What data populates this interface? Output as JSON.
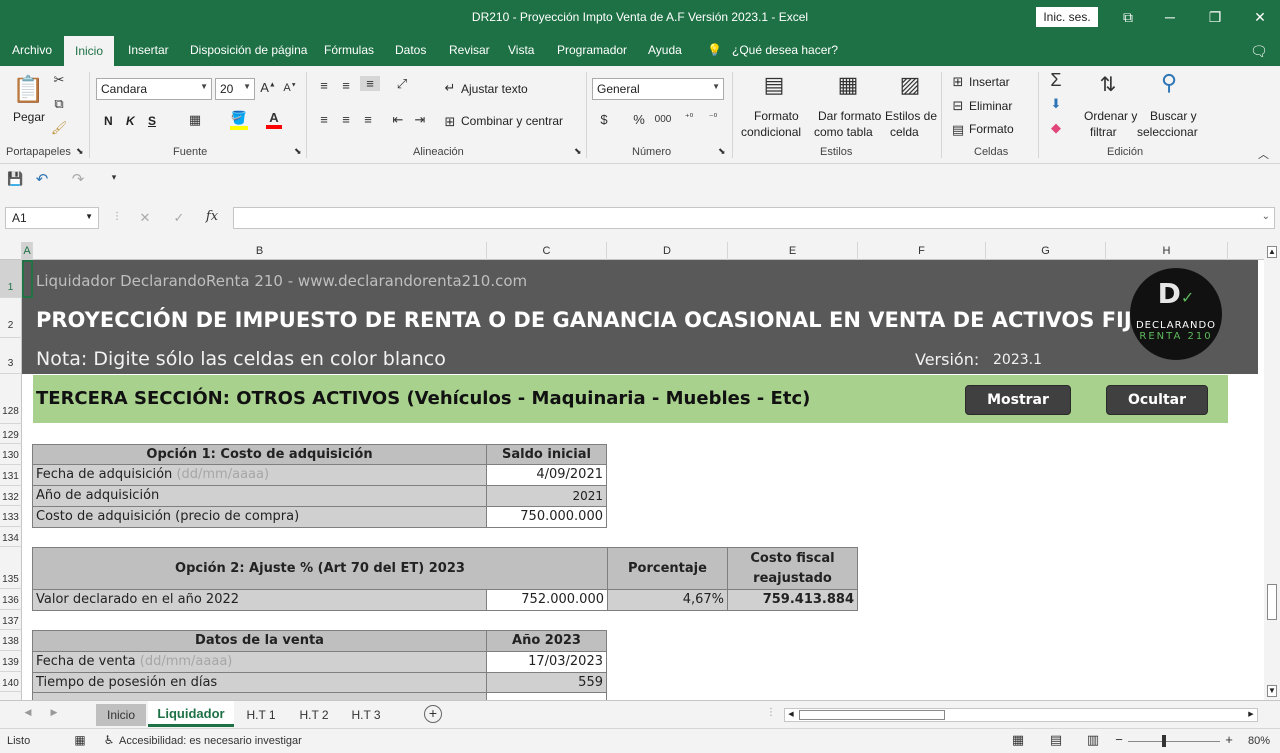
{
  "window": {
    "title": "DR210 - Proyección Impto Venta de A.F Versión 2023.1  -  Excel",
    "signin": "Inic. ses."
  },
  "menu": [
    "Archivo",
    "Inicio",
    "Insertar",
    "Disposición de página",
    "Fórmulas",
    "Datos",
    "Revisar",
    "Vista",
    "Programador",
    "Ayuda",
    "¿Qué desea hacer?"
  ],
  "ribbon": {
    "clipboard": {
      "paste": "Pegar",
      "group": "Portapapeles"
    },
    "font": {
      "name": "Candara",
      "size": "20",
      "bold": "N",
      "italic": "K",
      "underline": "S",
      "group": "Fuente"
    },
    "alignment": {
      "wrap": "Ajustar texto",
      "merge": "Combinar y centrar",
      "group": "Alineación"
    },
    "number": {
      "format": "General",
      "group": "Número"
    },
    "styles": {
      "conditional": [
        "Formato",
        "condicional"
      ],
      "table": [
        "Dar formato",
        "como tabla"
      ],
      "cell": [
        "Estilos de",
        "celda"
      ],
      "group": "Estilos"
    },
    "cells": {
      "insert": "Insertar",
      "delete": "Eliminar",
      "format": "Formato",
      "group": "Celdas"
    },
    "editing": {
      "sort": [
        "Ordenar y",
        "filtrar"
      ],
      "find": [
        "Buscar y",
        "seleccionar"
      ],
      "group": "Edición"
    }
  },
  "formula_bar": {
    "name_box": "A1",
    "formula": ""
  },
  "columns": [
    "A",
    "B",
    "C",
    "D",
    "E",
    "F",
    "G",
    "H"
  ],
  "rows": [
    "1",
    "2",
    "3",
    "128",
    "129",
    "130",
    "131",
    "132",
    "133",
    "134",
    "135",
    "136",
    "137",
    "138",
    "139",
    "140"
  ],
  "banner": {
    "line1": "Liquidador DeclarandoRenta 210 - www.declarandorenta210.com",
    "line2": "PROYECCIÓN DE IMPUESTO DE RENTA O DE GANANCIA OCASIONAL EN VENTA DE ACTIVOS FIJOS",
    "line3": "Nota: Digite sólo las celdas en color blanco",
    "version_label": "Versión:",
    "version": "2023.1",
    "logo_top": "DECLARANDO",
    "logo_bottom": "RENTA 210"
  },
  "section": {
    "title": "TERCERA SECCIÓN: OTROS ACTIVOS (Vehículos - Maquinaria - Muebles - Etc)",
    "show": "Mostrar",
    "hide": "Ocultar"
  },
  "option1": {
    "header": "Opción 1: Costo de adquisición",
    "col": "Saldo inicial",
    "rows": [
      {
        "label": "Fecha de adquisición ",
        "hint": "(dd/mm/aaaa)",
        "value": "4/09/2021"
      },
      {
        "label": "Año de adquisición",
        "hint": "",
        "value": "2021"
      },
      {
        "label": "Costo de adquisición (precio de compra)",
        "hint": "",
        "value": "750.000.000"
      }
    ]
  },
  "option2": {
    "header": "Opción 2: Ajuste % (Art 70 del ET) 2023",
    "col_pct": "Porcentaje",
    "col_cost": [
      "Costo fiscal",
      "reajustado"
    ],
    "label": "Valor declarado en el año 2022",
    "value": "752.000.000",
    "pct": "4,67%",
    "cost": "759.413.884"
  },
  "sale": {
    "header": "Datos de la venta",
    "col": "Año 2023",
    "rows": [
      {
        "label": "Fecha de venta ",
        "hint": "(dd/mm/aaaa)",
        "value": "17/03/2023"
      },
      {
        "label": "Tiempo de posesión en días",
        "hint": "",
        "value": "559"
      }
    ]
  },
  "sheets": [
    "Inicio",
    "Liquidador",
    "H.T 1",
    "H.T 2",
    "H.T 3"
  ],
  "status": {
    "ready": "Listo",
    "accessibility": "Accesibilidad: es necesario investigar",
    "zoom": "80%"
  }
}
